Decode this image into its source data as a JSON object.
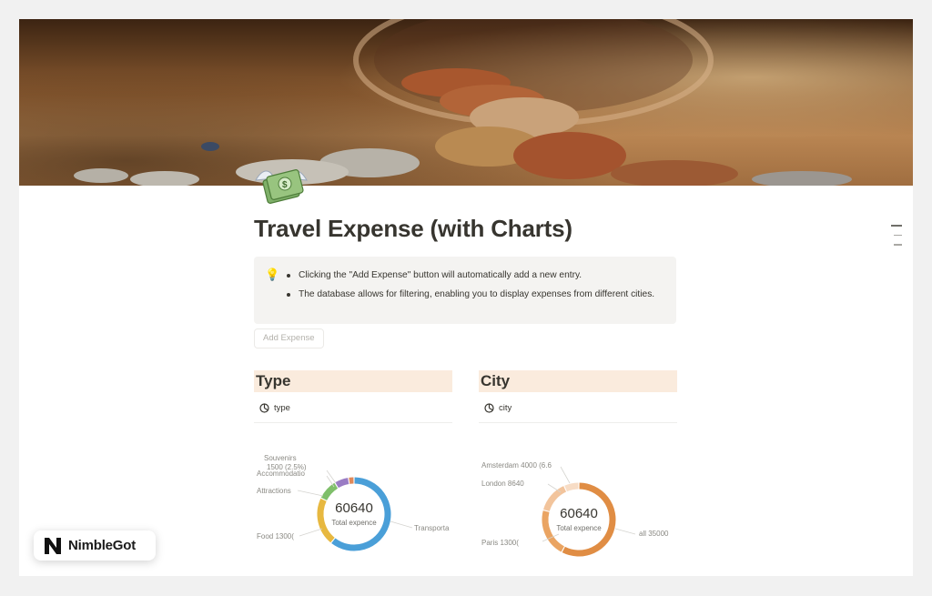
{
  "page": {
    "title": "Travel Expense (with Charts)",
    "icon": "money-with-wings-icon"
  },
  "callout": {
    "icon": "lightbulb-icon",
    "items": [
      "Clicking the \"Add Expense\" button will automatically add a new entry.",
      "The database allows for filtering, enabling you to display expenses from different cities."
    ]
  },
  "add_button": {
    "label": "Add Expense"
  },
  "sections": {
    "type": {
      "heading": "Type",
      "view": "type"
    },
    "city": {
      "heading": "City",
      "view": "city"
    }
  },
  "chart_data": [
    {
      "type": "pie",
      "style": "donut",
      "center_value": "60640",
      "center_label": "Total expence",
      "labels_shown": [
        "Souvenirs 1500 (2.5%)",
        "Accommodatio",
        "Attractions",
        "Food 1300(",
        "Transporta"
      ],
      "slices": [
        {
          "name": "Transportation",
          "value": 36840,
          "color": "#4a9fd8"
        },
        {
          "name": "Food",
          "value": 13000,
          "color": "#e7b840"
        },
        {
          "name": "Attractions",
          "value": 5500,
          "color": "#7fbf6a"
        },
        {
          "name": "Accommodation",
          "value": 3800,
          "color": "#9a7cc4"
        },
        {
          "name": "Souvenirs",
          "value": 1500,
          "color": "#e0895a"
        }
      ],
      "legend_shown": [
        "Transportation",
        "Food"
      ],
      "legend_placement": "bottom"
    },
    {
      "type": "pie",
      "style": "donut",
      "center_value": "60640",
      "center_label": "Total expence",
      "labels_shown": [
        "Amsterdam 4000 (6.6",
        "London 8640",
        "Paris 1300(",
        "all 35000"
      ],
      "slices": [
        {
          "name": "all",
          "value": 35000,
          "color": "#e08d44"
        },
        {
          "name": "Paris",
          "value": 13000,
          "color": "#eaa462"
        },
        {
          "name": "London",
          "value": 8640,
          "color": "#f2c49c"
        },
        {
          "name": "Amsterdam",
          "value": 4000,
          "color": "#f7dcc5"
        }
      ],
      "legend_placement": "bottom"
    }
  ],
  "brand": {
    "name": "NimbleGot",
    "logo": "nimblegot-logo-icon"
  },
  "colors": {
    "section_header_bg": "#faebdd",
    "callout_bg": "#f4f3f1",
    "text": "#37352f"
  }
}
